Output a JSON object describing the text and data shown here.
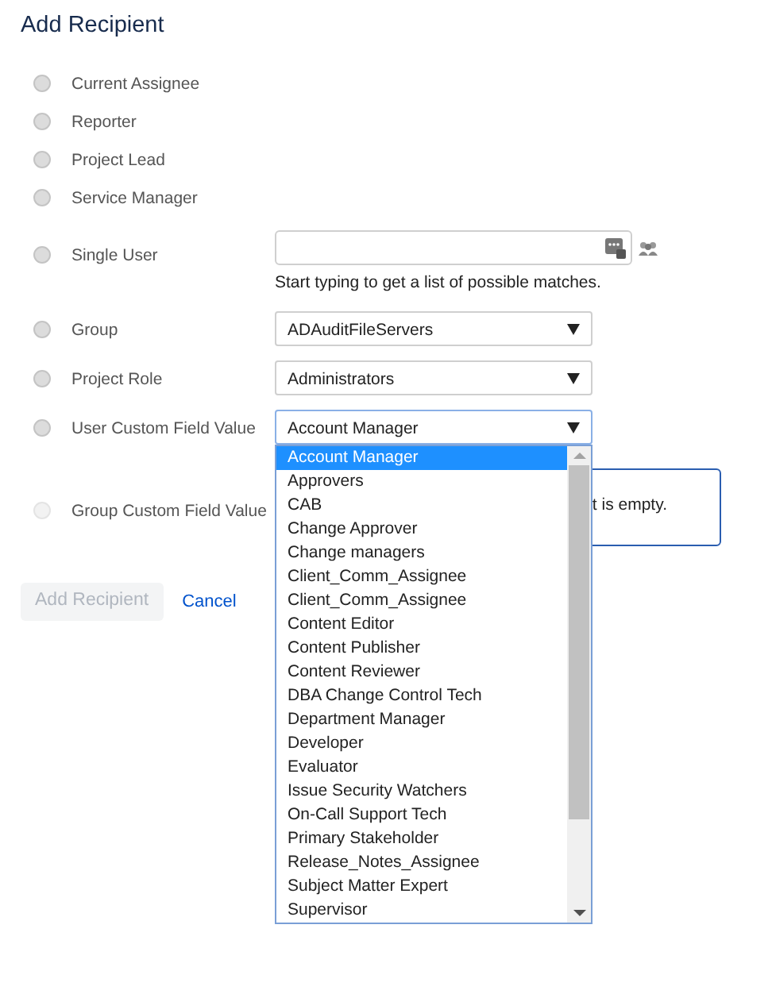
{
  "title": "Add Recipient",
  "options": [
    {
      "label": "Current Assignee",
      "kind": "plain",
      "selected": false,
      "disabled": false
    },
    {
      "label": "Reporter",
      "kind": "plain",
      "selected": false,
      "disabled": false
    },
    {
      "label": "Project Lead",
      "kind": "plain",
      "selected": false,
      "disabled": false
    },
    {
      "label": "Service Manager",
      "kind": "plain",
      "selected": false,
      "disabled": false
    },
    {
      "label": "Single User",
      "kind": "user",
      "selected": false,
      "disabled": false,
      "hint": "Start typing to get a list of possible matches."
    },
    {
      "label": "Group",
      "kind": "select",
      "selected": false,
      "disabled": false,
      "value": "ADAuditFileServers"
    },
    {
      "label": "Project Role",
      "kind": "select",
      "selected": false,
      "disabled": false,
      "value": "Administrators"
    },
    {
      "label": "User Custom Field Value",
      "kind": "select",
      "selected": false,
      "disabled": false,
      "value": "Account Manager",
      "expanded": true
    },
    {
      "label": "Group Custom Field Value",
      "kind": "message",
      "selected": false,
      "disabled": true,
      "message": "t is empty."
    }
  ],
  "dropdown": [
    {
      "label": "Account Manager",
      "selected": true
    },
    {
      "label": "Approvers",
      "selected": false
    },
    {
      "label": "CAB",
      "selected": false
    },
    {
      "label": "Change Approver",
      "selected": false
    },
    {
      "label": "Change managers",
      "selected": false
    },
    {
      "label": "Client_Comm_Assignee",
      "selected": false
    },
    {
      "label": "Client_Comm_Assignee",
      "selected": false
    },
    {
      "label": "Content Editor",
      "selected": false
    },
    {
      "label": "Content Publisher",
      "selected": false
    },
    {
      "label": "Content Reviewer",
      "selected": false
    },
    {
      "label": "DBA Change Control Tech",
      "selected": false
    },
    {
      "label": "Department Manager",
      "selected": false
    },
    {
      "label": "Developer",
      "selected": false
    },
    {
      "label": "Evaluator",
      "selected": false
    },
    {
      "label": "Issue Security Watchers",
      "selected": false
    },
    {
      "label": "On-Call Support Tech",
      "selected": false
    },
    {
      "label": "Primary Stakeholder",
      "selected": false
    },
    {
      "label": "Release_Notes_Assignee",
      "selected": false
    },
    {
      "label": "Subject Matter Expert",
      "selected": false
    },
    {
      "label": "Supervisor",
      "selected": false
    }
  ],
  "buttons": {
    "submit": {
      "label": "Add Recipient",
      "disabled": true
    },
    "cancel": "Cancel"
  }
}
